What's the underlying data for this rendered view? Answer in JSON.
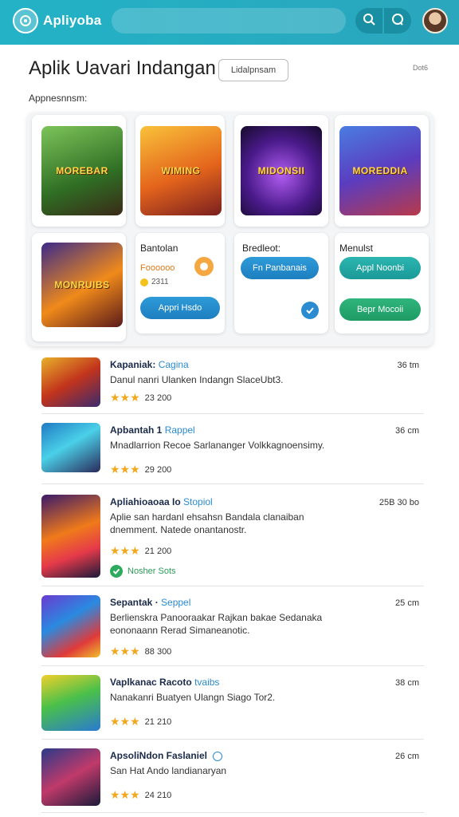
{
  "header": {
    "app_name": "Apliyoba",
    "search_icon": "search-icon",
    "chat_icon": "chat-icon"
  },
  "title_area": {
    "title": "Aplik Uavari Indangan",
    "chip": "Lidalpnsam",
    "top_right": "Dot6"
  },
  "section_label": "Appnesnnsm:",
  "featured": {
    "tiles": [
      {
        "art_title": "MOREBAR",
        "colors": [
          "#6bb34a",
          "#3a7a2a"
        ]
      },
      {
        "art_title": "WIMING",
        "colors": [
          "#f7a51c",
          "#c8441c"
        ]
      },
      {
        "art_title": "MIDONSII",
        "colors": [
          "#7b2ec9",
          "#1e0d3a"
        ]
      },
      {
        "art_title": "MOREDDIA",
        "colors": [
          "#3c62c7",
          "#c33c4f"
        ]
      },
      {
        "art_title": "MONRUIBS",
        "colors": [
          "#f28c1a",
          "#3a1f6e"
        ]
      }
    ],
    "card_a": {
      "label": "Bantolan",
      "price": "Foooooo",
      "coins": "2311",
      "button": "Appri Hsdo"
    },
    "card_b": {
      "label": "Bredleot:",
      "button": "Fn Panbanais"
    },
    "card_c": {
      "label": "Menulst",
      "button_top": "Appl Noonbi",
      "button_bottom": "Bepr Mocoii"
    }
  },
  "list": [
    {
      "title": "Kapaniak:",
      "tag": "Cagina",
      "desc": "Danul nanri Ulanken Indangn SlaceUbt3.",
      "rating": "23 200",
      "time": "36 tm"
    },
    {
      "title": "Apbantah 1",
      "tag": "Rappel",
      "desc": "Mnadlarrion Recoe Sarlananger Volkkagnoensimy.",
      "rating": "29 200",
      "time": "36 cm"
    },
    {
      "title": "Apliahioaoaa Io",
      "tag": "Stopiol",
      "desc": "Aplie san hardanl ehsahsn Bandala clanaiban dnemment. Natede onantanostr.",
      "rating": "21 200",
      "time": "25B 30 bo",
      "verified": "Nosher Sots"
    },
    {
      "title": "Sepantak ·",
      "tag": "Seppel",
      "desc": "Berlienskra Panooraakar Rajkan bakae Sedanaka eononaann Rerad Simaneanotic.",
      "rating": "88 300",
      "time": "25 cm"
    },
    {
      "title": "Vaplkanac Racoto",
      "tag": "tvaibs",
      "desc": "Nanakanri Buatyen Ulangn Siago Tor2.",
      "rating": "21 210",
      "time": "38 cm"
    },
    {
      "title": "ApsoliNdon Faslaniel",
      "tag": "",
      "desc": "San Hat Ando landianaryan",
      "rating": "24 210",
      "time": "26 cm"
    }
  ]
}
